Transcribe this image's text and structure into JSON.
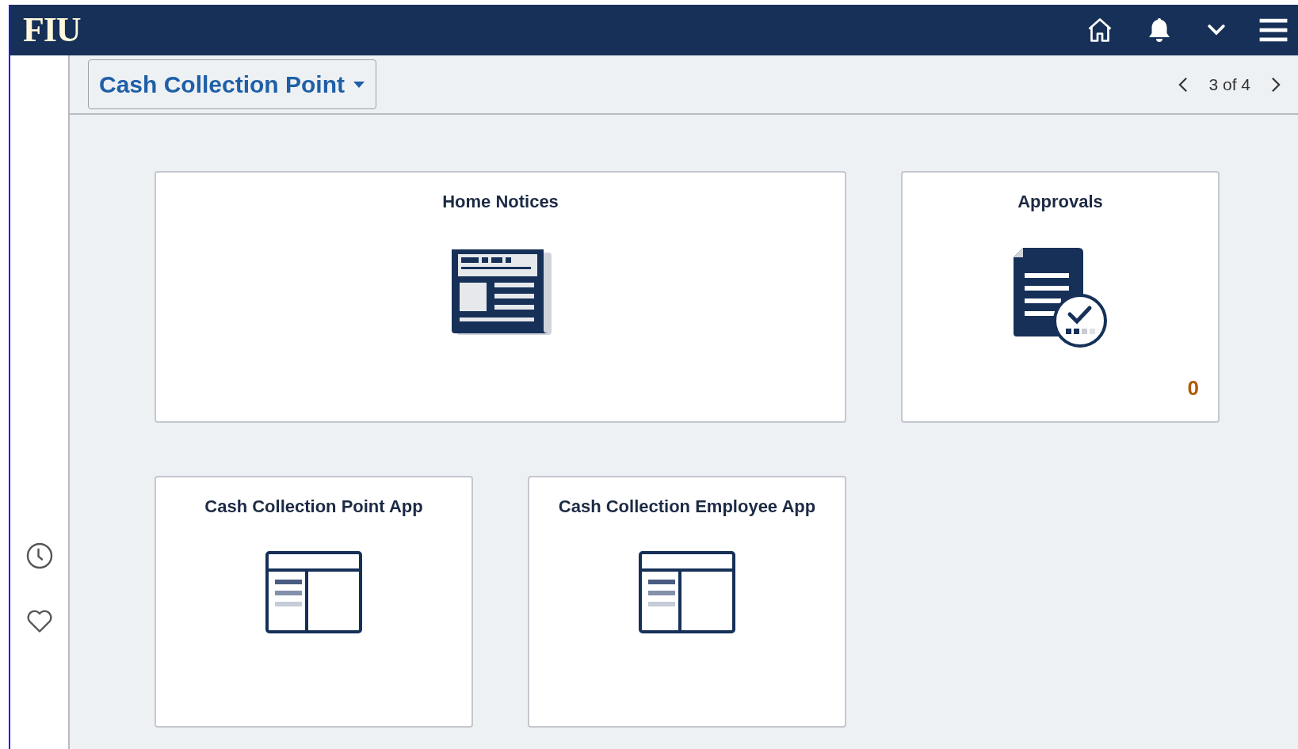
{
  "header": {
    "logo": "FIU"
  },
  "context": {
    "title": "Cash Collection Point",
    "pager": "3 of 4"
  },
  "tiles": [
    {
      "kind": "notices",
      "title": "Home Notices"
    },
    {
      "kind": "approvals",
      "title": "Approvals",
      "count": "0"
    },
    {
      "kind": "app",
      "title": "Cash Collection Point App"
    },
    {
      "kind": "app",
      "title": "Cash Collection Employee App"
    }
  ]
}
